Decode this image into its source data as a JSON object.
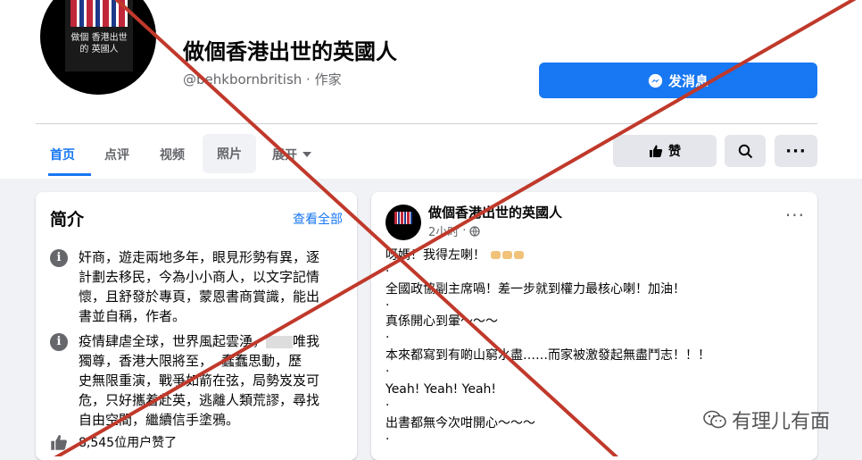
{
  "page": {
    "name": "做個香港出世的英國人",
    "handle": "@behkbornbritish · 作家",
    "avatar_text": "做個 香港出世的 英國人"
  },
  "actions": {
    "message_label": "发消息",
    "like_label": "赞"
  },
  "tabs": [
    {
      "label": "首页",
      "active": true
    },
    {
      "label": "点评"
    },
    {
      "label": "视频"
    },
    {
      "label": "照片"
    },
    {
      "label": "展开"
    }
  ],
  "intro": {
    "title": "简介",
    "see_all": "查看全部",
    "items": [
      {
        "lines": [
          "奸商，遊走兩地多年，眼見形勢有異，逐",
          "計劃去移民，今為小小商人，以文字記情",
          "懷，且舒發於專頁，蒙恩書商賞識，能出",
          "書並自稱，作者。"
        ]
      },
      {
        "lines": [
          "疫情肆虐全球，世界風起雲湧，",
          "唯我",
          "獨尊，香港大限將至，",
          "蠢蠢思動，歷",
          "史無限重演，戰爭如箭在弦，局勢岌岌可",
          "危，只好攜着赴英，逃離人類荒謬，尋找",
          "自由空間，繼續信手塗鴉。"
        ]
      }
    ],
    "likes": "8,545位用户赞了"
  },
  "post": {
    "author": "做個香港出世的英國人",
    "time": "2小时",
    "lines": [
      "呀媽！我得左喇！",
      "·",
      "全國政協副主席喎！差一步就到權力最核心喇！加油！",
      "·",
      "真係開心到暈～～～",
      "·",
      "本來都寫到有啲山窮水盡……而家被激發起無盡鬥志！！！",
      "·",
      "Yeah! Yeah! Yeah!",
      "·",
      "出書都無今次咁開心～～～",
      "·"
    ]
  },
  "watermark": "有理儿有面",
  "colors": {
    "accent": "#1877f2",
    "x_mark": "#c0392b",
    "secondary_text": "#65676b"
  }
}
